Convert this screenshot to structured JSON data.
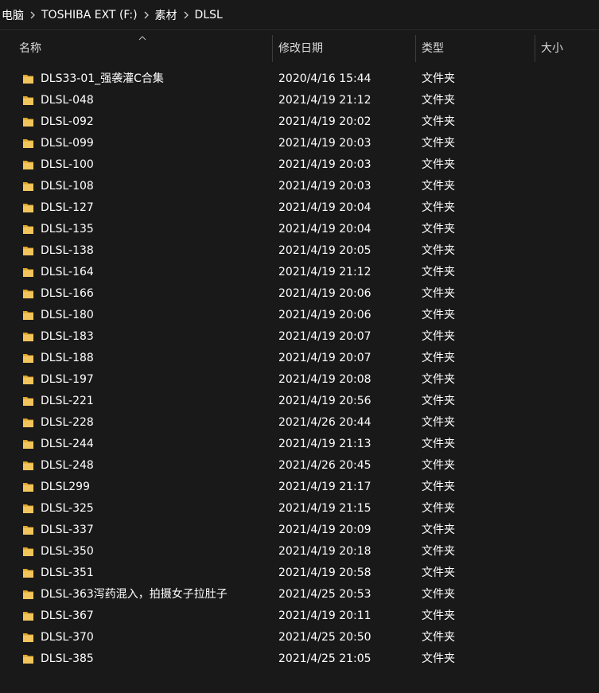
{
  "breadcrumb": {
    "items": [
      "电脑",
      "TOSHIBA EXT (F:)",
      "素材",
      "DLSL"
    ]
  },
  "columns": {
    "name": "名称",
    "date": "修改日期",
    "type": "类型",
    "size": "大小"
  },
  "colors": {
    "background": "#191919",
    "text": "#ffffff",
    "folder": "#f2c55c"
  },
  "files": [
    {
      "name": "DLS33-01_强袭灌C合集",
      "date": "2020/4/16 15:44",
      "type": "文件夹"
    },
    {
      "name": "DLSL-048",
      "date": "2021/4/19 21:12",
      "type": "文件夹"
    },
    {
      "name": "DLSL-092",
      "date": "2021/4/19 20:02",
      "type": "文件夹"
    },
    {
      "name": "DLSL-099",
      "date": "2021/4/19 20:03",
      "type": "文件夹"
    },
    {
      "name": "DLSL-100",
      "date": "2021/4/19 20:03",
      "type": "文件夹"
    },
    {
      "name": "DLSL-108",
      "date": "2021/4/19 20:03",
      "type": "文件夹"
    },
    {
      "name": "DLSL-127",
      "date": "2021/4/19 20:04",
      "type": "文件夹"
    },
    {
      "name": "DLSL-135",
      "date": "2021/4/19 20:04",
      "type": "文件夹"
    },
    {
      "name": "DLSL-138",
      "date": "2021/4/19 20:05",
      "type": "文件夹"
    },
    {
      "name": "DLSL-164",
      "date": "2021/4/19 21:12",
      "type": "文件夹"
    },
    {
      "name": "DLSL-166",
      "date": "2021/4/19 20:06",
      "type": "文件夹"
    },
    {
      "name": "DLSL-180",
      "date": "2021/4/19 20:06",
      "type": "文件夹"
    },
    {
      "name": "DLSL-183",
      "date": "2021/4/19 20:07",
      "type": "文件夹"
    },
    {
      "name": "DLSL-188",
      "date": "2021/4/19 20:07",
      "type": "文件夹"
    },
    {
      "name": "DLSL-197",
      "date": "2021/4/19 20:08",
      "type": "文件夹"
    },
    {
      "name": "DLSL-221",
      "date": "2021/4/19 20:56",
      "type": "文件夹"
    },
    {
      "name": "DLSL-228",
      "date": "2021/4/26 20:44",
      "type": "文件夹"
    },
    {
      "name": "DLSL-244",
      "date": "2021/4/19 21:13",
      "type": "文件夹"
    },
    {
      "name": "DLSL-248",
      "date": "2021/4/26 20:45",
      "type": "文件夹"
    },
    {
      "name": "DLSL299",
      "date": "2021/4/19 21:17",
      "type": "文件夹"
    },
    {
      "name": "DLSL-325",
      "date": "2021/4/19 21:15",
      "type": "文件夹"
    },
    {
      "name": "DLSL-337",
      "date": "2021/4/19 20:09",
      "type": "文件夹"
    },
    {
      "name": "DLSL-350",
      "date": "2021/4/19 20:18",
      "type": "文件夹"
    },
    {
      "name": "DLSL-351",
      "date": "2021/4/19 20:58",
      "type": "文件夹"
    },
    {
      "name": "DLSL-363泻药混入，拍摄女子拉肚子",
      "date": "2021/4/25 20:53",
      "type": "文件夹"
    },
    {
      "name": "DLSL-367",
      "date": "2021/4/19 20:11",
      "type": "文件夹"
    },
    {
      "name": "DLSL-370",
      "date": "2021/4/25 20:50",
      "type": "文件夹"
    },
    {
      "name": "DLSL-385",
      "date": "2021/4/25 21:05",
      "type": "文件夹"
    }
  ]
}
